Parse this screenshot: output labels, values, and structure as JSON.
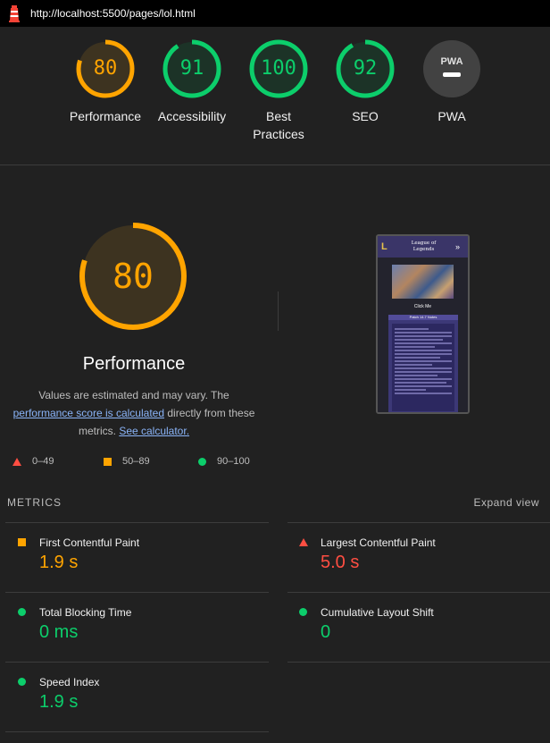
{
  "url": "http://localhost:5500/pages/lol.html",
  "gauges": [
    {
      "score": "80",
      "label": "Performance",
      "value": 80,
      "color": "#ffa400",
      "bg": "#3d3320"
    },
    {
      "score": "91",
      "label": "Accessibility",
      "value": 91,
      "color": "#0cce6b",
      "bg": "#1c3327"
    },
    {
      "score": "100",
      "label": "Best Practices",
      "value": 100,
      "color": "#0cce6b",
      "bg": "#1c3327"
    },
    {
      "score": "92",
      "label": "SEO",
      "value": 92,
      "color": "#0cce6b",
      "bg": "#1c3327"
    },
    {
      "label": "PWA",
      "badge": "PWA"
    }
  ],
  "performance": {
    "score": "80",
    "value": 80,
    "title": "Performance",
    "desc_prefix": "Values are estimated and may vary. The",
    "desc_link": "performance score is calculated",
    "desc_mid": "directly from these metrics.",
    "desc_link2": "See calculator."
  },
  "thumbnail": {
    "site_title_line1": "League of",
    "site_title_line2": "Legends",
    "button": "Click Me",
    "card_title": "Patch 14.7 Notes"
  },
  "legend": [
    {
      "range": "0–49",
      "shape": "triangle",
      "color": "#ff4e42"
    },
    {
      "range": "50–89",
      "shape": "square",
      "color": "#ffa400"
    },
    {
      "range": "90–100",
      "shape": "circle",
      "color": "#0cce6b"
    }
  ],
  "metrics_header": "METRICS",
  "expand_view": "Expand view",
  "metrics": [
    {
      "name": "First Contentful Paint",
      "value": "1.9 s",
      "status": "average",
      "color": "#ffa400"
    },
    {
      "name": "Largest Contentful Paint",
      "value": "5.0 s",
      "status": "fail",
      "color": "#ff4e42"
    },
    {
      "name": "Total Blocking Time",
      "value": "0 ms",
      "status": "pass",
      "color": "#0cce6b"
    },
    {
      "name": "Cumulative Layout Shift",
      "value": "0",
      "status": "pass",
      "color": "#0cce6b"
    },
    {
      "name": "Speed Index",
      "value": "1.9 s",
      "status": "pass",
      "color": "#0cce6b"
    }
  ]
}
